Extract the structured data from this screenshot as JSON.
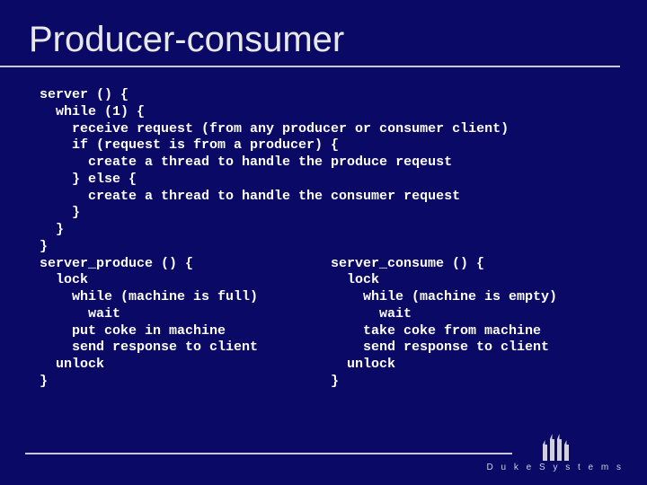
{
  "title": "Producer-consumer",
  "code_top": "server () {\n  while (1) {\n    receive request (from any producer or consumer client)\n    if (request is from a producer) {\n      create a thread to handle the produce reqeust\n    } else {\n      create a thread to handle the consumer request\n    }\n  }\n}",
  "code_left": "server_produce () {\n  lock\n    while (machine is full)\n      wait\n    put coke in machine\n    send response to client\n  unlock\n}",
  "code_right": "server_consume () {\n  lock\n    while (machine is empty)\n      wait\n    take coke from machine\n    send response to client\n  unlock\n}",
  "footer": {
    "brand": "D u k e  S y s t e m s"
  }
}
